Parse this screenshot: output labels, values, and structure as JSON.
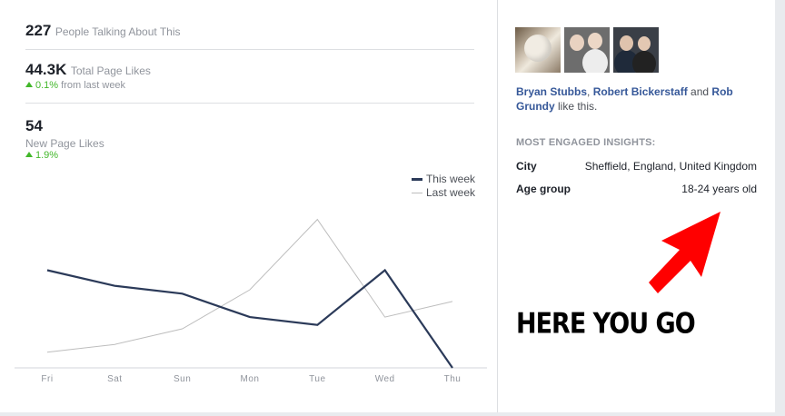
{
  "stats": {
    "people_talking_value": "227",
    "people_talking_label": "People Talking About This",
    "total_likes_value": "44.3K",
    "total_likes_label": "Total Page Likes",
    "total_likes_change": "0.1%",
    "total_likes_change_suffix": "from last week",
    "new_likes_value": "54",
    "new_likes_label": "New Page Likes",
    "new_likes_change": "1.9%"
  },
  "chart_data": {
    "type": "line",
    "categories": [
      "Fri",
      "Sat",
      "Sun",
      "Mon",
      "Tue",
      "Wed",
      "Thu"
    ],
    "series": [
      {
        "name": "This week",
        "values": [
          12.5,
          10.5,
          9.5,
          6.5,
          5.5,
          12.5,
          0
        ],
        "color": "#2b3a59"
      },
      {
        "name": "Last week",
        "values": [
          2,
          3,
          5,
          10,
          19,
          6.5,
          8.5
        ],
        "color": "#bdbdbd"
      }
    ],
    "ylim": [
      0,
      20
    ],
    "legend": "top-right",
    "grid": false
  },
  "friends": {
    "names": [
      "Bryan Stubbs",
      "Robert Bickerstaff",
      "Rob Grundy"
    ],
    "sep1": ", ",
    "sep2": " and ",
    "suffix": " like this."
  },
  "insights": {
    "title": "MOST ENGAGED INSIGHTS:",
    "rows": [
      {
        "label": "City",
        "value": "Sheffield, England, United Kingdom"
      },
      {
        "label": "Age group",
        "value": "18-24 years old"
      }
    ]
  },
  "annotation": {
    "text": "HERE YOU GO",
    "arrow_color": "#ff0000"
  }
}
